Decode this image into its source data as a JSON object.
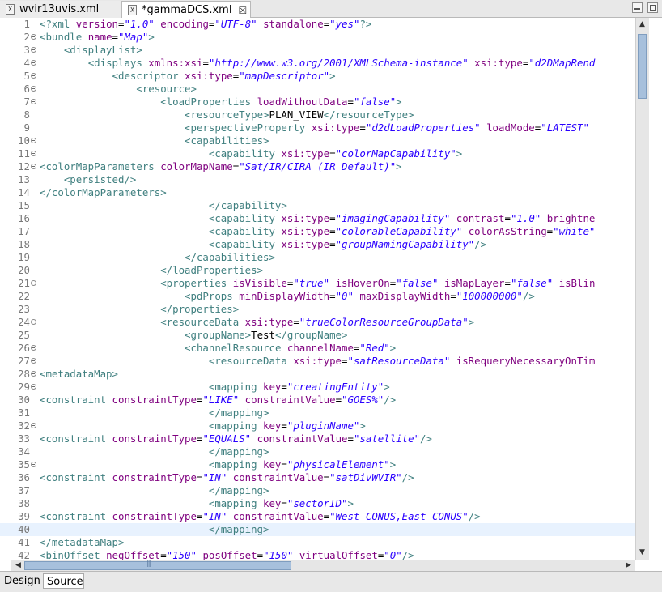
{
  "tabs": [
    {
      "label": "wvir13uvis.xml",
      "icon": "xml-file-icon",
      "active": false
    },
    {
      "label": "*gammaDCS.xml",
      "icon": "xml-file-icon",
      "active": true
    }
  ],
  "bottom_tabs": [
    {
      "label": "Design",
      "active": false
    },
    {
      "label": "Source",
      "active": true
    }
  ],
  "current_line": 40,
  "lines": [
    {
      "n": "1",
      "fold": false,
      "indent": "",
      "tokens": [
        [
          "pi",
          "<?xml "
        ],
        [
          "attr",
          "version"
        ],
        [
          "txt",
          "="
        ],
        [
          "val",
          "\"1.0\""
        ],
        [
          "txt",
          " "
        ],
        [
          "attr",
          "encoding"
        ],
        [
          "txt",
          "="
        ],
        [
          "val",
          "\"UTF-8\""
        ],
        [
          "txt",
          " "
        ],
        [
          "attr",
          "standalone"
        ],
        [
          "txt",
          "="
        ],
        [
          "val",
          "\"yes\""
        ],
        [
          "pi",
          "?>"
        ]
      ]
    },
    {
      "n": "2",
      "fold": true,
      "indent": "",
      "tokens": [
        [
          "tag",
          "<bundle "
        ],
        [
          "attr",
          "name"
        ],
        [
          "txt",
          "="
        ],
        [
          "val",
          "\"Map\""
        ],
        [
          "tag",
          ">"
        ]
      ]
    },
    {
      "n": "3",
      "fold": true,
      "indent": "    ",
      "tokens": [
        [
          "tag",
          "<displayList>"
        ]
      ]
    },
    {
      "n": "4",
      "fold": true,
      "indent": "        ",
      "tokens": [
        [
          "tag",
          "<displays "
        ],
        [
          "attr",
          "xmlns:xsi"
        ],
        [
          "txt",
          "="
        ],
        [
          "val",
          "\"http://www.w3.org/2001/XMLSchema-instance\""
        ],
        [
          "txt",
          " "
        ],
        [
          "attr",
          "xsi:type"
        ],
        [
          "txt",
          "="
        ],
        [
          "val",
          "\"d2DMapRend"
        ]
      ]
    },
    {
      "n": "5",
      "fold": true,
      "indent": "            ",
      "tokens": [
        [
          "tag",
          "<descriptor "
        ],
        [
          "attr",
          "xsi:type"
        ],
        [
          "txt",
          "="
        ],
        [
          "val",
          "\"mapDescriptor\""
        ],
        [
          "tag",
          ">"
        ]
      ]
    },
    {
      "n": "6",
      "fold": true,
      "indent": "                ",
      "tokens": [
        [
          "tag",
          "<resource>"
        ]
      ]
    },
    {
      "n": "7",
      "fold": true,
      "indent": "                    ",
      "tokens": [
        [
          "tag",
          "<loadProperties "
        ],
        [
          "attr",
          "loadWithoutData"
        ],
        [
          "txt",
          "="
        ],
        [
          "val",
          "\"false\""
        ],
        [
          "tag",
          ">"
        ]
      ]
    },
    {
      "n": "8",
      "fold": false,
      "indent": "                        ",
      "tokens": [
        [
          "tag",
          "<resourceType>"
        ],
        [
          "txt",
          "PLAN_VIEW"
        ],
        [
          "tag",
          "</resourceType>"
        ]
      ]
    },
    {
      "n": "9",
      "fold": false,
      "indent": "                        ",
      "tokens": [
        [
          "tag",
          "<perspectiveProperty "
        ],
        [
          "attr",
          "xsi:type"
        ],
        [
          "txt",
          "="
        ],
        [
          "val",
          "\"d2dLoadProperties\""
        ],
        [
          "txt",
          " "
        ],
        [
          "attr",
          "loadMode"
        ],
        [
          "txt",
          "="
        ],
        [
          "val",
          "\"LATEST\""
        ]
      ]
    },
    {
      "n": "10",
      "fold": true,
      "indent": "                        ",
      "tokens": [
        [
          "tag",
          "<capabilities>"
        ]
      ]
    },
    {
      "n": "11",
      "fold": true,
      "indent": "                            ",
      "tokens": [
        [
          "tag",
          "<capability "
        ],
        [
          "attr",
          "xsi:type"
        ],
        [
          "txt",
          "="
        ],
        [
          "val",
          "\"colorMapCapability\""
        ],
        [
          "tag",
          ">"
        ]
      ]
    },
    {
      "n": "12",
      "fold": true,
      "indent": "",
      "tokens": [
        [
          "tag",
          "<colorMapParameters "
        ],
        [
          "attr",
          "colorMapName"
        ],
        [
          "txt",
          "="
        ],
        [
          "val",
          "\"Sat/IR/CIRA (IR Default)\""
        ],
        [
          "tag",
          ">"
        ]
      ]
    },
    {
      "n": "13",
      "fold": false,
      "indent": "    ",
      "tokens": [
        [
          "tag",
          "<persisted/>"
        ]
      ]
    },
    {
      "n": "14",
      "fold": false,
      "indent": "",
      "tokens": [
        [
          "tag",
          "</colorMapParameters>"
        ]
      ]
    },
    {
      "n": "15",
      "fold": false,
      "indent": "                            ",
      "tokens": [
        [
          "tag",
          "</capability>"
        ]
      ]
    },
    {
      "n": "16",
      "fold": false,
      "indent": "                            ",
      "tokens": [
        [
          "tag",
          "<capability "
        ],
        [
          "attr",
          "xsi:type"
        ],
        [
          "txt",
          "="
        ],
        [
          "val",
          "\"imagingCapability\""
        ],
        [
          "txt",
          " "
        ],
        [
          "attr",
          "contrast"
        ],
        [
          "txt",
          "="
        ],
        [
          "val",
          "\"1.0\""
        ],
        [
          "txt",
          " "
        ],
        [
          "attr",
          "brightne"
        ]
      ]
    },
    {
      "n": "17",
      "fold": false,
      "indent": "                            ",
      "tokens": [
        [
          "tag",
          "<capability "
        ],
        [
          "attr",
          "xsi:type"
        ],
        [
          "txt",
          "="
        ],
        [
          "val",
          "\"colorableCapability\""
        ],
        [
          "txt",
          " "
        ],
        [
          "attr",
          "colorAsString"
        ],
        [
          "txt",
          "="
        ],
        [
          "val",
          "\"white\""
        ]
      ]
    },
    {
      "n": "18",
      "fold": false,
      "indent": "                            ",
      "tokens": [
        [
          "tag",
          "<capability "
        ],
        [
          "attr",
          "xsi:type"
        ],
        [
          "txt",
          "="
        ],
        [
          "val",
          "\"groupNamingCapability\""
        ],
        [
          "tag",
          "/>"
        ]
      ]
    },
    {
      "n": "19",
      "fold": false,
      "indent": "                        ",
      "tokens": [
        [
          "tag",
          "</capabilities>"
        ]
      ]
    },
    {
      "n": "20",
      "fold": false,
      "indent": "                    ",
      "tokens": [
        [
          "tag",
          "</loadProperties>"
        ]
      ]
    },
    {
      "n": "21",
      "fold": true,
      "indent": "                    ",
      "tokens": [
        [
          "tag",
          "<properties "
        ],
        [
          "attr",
          "isVisible"
        ],
        [
          "txt",
          "="
        ],
        [
          "val",
          "\"true\""
        ],
        [
          "txt",
          " "
        ],
        [
          "attr",
          "isHoverOn"
        ],
        [
          "txt",
          "="
        ],
        [
          "val",
          "\"false\""
        ],
        [
          "txt",
          " "
        ],
        [
          "attr",
          "isMapLayer"
        ],
        [
          "txt",
          "="
        ],
        [
          "val",
          "\"false\""
        ],
        [
          "txt",
          " "
        ],
        [
          "attr",
          "isBlin"
        ]
      ]
    },
    {
      "n": "22",
      "fold": false,
      "indent": "                        ",
      "tokens": [
        [
          "tag",
          "<pdProps "
        ],
        [
          "attr",
          "minDisplayWidth"
        ],
        [
          "txt",
          "="
        ],
        [
          "val",
          "\"0\""
        ],
        [
          "txt",
          " "
        ],
        [
          "attr",
          "maxDisplayWidth"
        ],
        [
          "txt",
          "="
        ],
        [
          "val",
          "\"100000000\""
        ],
        [
          "tag",
          "/>"
        ]
      ]
    },
    {
      "n": "23",
      "fold": false,
      "indent": "                    ",
      "tokens": [
        [
          "tag",
          "</properties>"
        ]
      ]
    },
    {
      "n": "24",
      "fold": true,
      "indent": "                    ",
      "tokens": [
        [
          "tag",
          "<resourceData "
        ],
        [
          "attr",
          "xsi:type"
        ],
        [
          "txt",
          "="
        ],
        [
          "val",
          "\"trueColorResourceGroupData\""
        ],
        [
          "tag",
          ">"
        ]
      ]
    },
    {
      "n": "25",
      "fold": false,
      "indent": "                        ",
      "tokens": [
        [
          "tag",
          "<groupName>"
        ],
        [
          "txt",
          "Test"
        ],
        [
          "tag",
          "</groupName>"
        ]
      ]
    },
    {
      "n": "26",
      "fold": true,
      "indent": "                        ",
      "tokens": [
        [
          "tag",
          "<channelResource "
        ],
        [
          "attr",
          "channelName"
        ],
        [
          "txt",
          "="
        ],
        [
          "val",
          "\"Red\""
        ],
        [
          "tag",
          ">"
        ]
      ]
    },
    {
      "n": "27",
      "fold": true,
      "indent": "                            ",
      "tokens": [
        [
          "tag",
          "<resourceData "
        ],
        [
          "attr",
          "xsi:type"
        ],
        [
          "txt",
          "="
        ],
        [
          "val",
          "\"satResourceData\""
        ],
        [
          "txt",
          " "
        ],
        [
          "attr",
          "isRequeryNecessaryOnTim"
        ]
      ]
    },
    {
      "n": "28",
      "fold": true,
      "indent": "",
      "tokens": [
        [
          "tag",
          "<metadataMap>"
        ]
      ]
    },
    {
      "n": "29",
      "fold": true,
      "indent": "                            ",
      "tokens": [
        [
          "tag",
          "<mapping "
        ],
        [
          "attr",
          "key"
        ],
        [
          "txt",
          "="
        ],
        [
          "val",
          "\"creatingEntity\""
        ],
        [
          "tag",
          ">"
        ]
      ]
    },
    {
      "n": "30",
      "fold": false,
      "indent": "",
      "tokens": [
        [
          "tag",
          "<constraint "
        ],
        [
          "attr",
          "constraintType"
        ],
        [
          "txt",
          "="
        ],
        [
          "val",
          "\"LIKE\""
        ],
        [
          "txt",
          " "
        ],
        [
          "attr",
          "constraintValue"
        ],
        [
          "txt",
          "="
        ],
        [
          "val",
          "\"GOES%\""
        ],
        [
          "tag",
          "/>"
        ]
      ]
    },
    {
      "n": "31",
      "fold": false,
      "indent": "                            ",
      "tokens": [
        [
          "tag",
          "</mapping>"
        ]
      ]
    },
    {
      "n": "32",
      "fold": true,
      "indent": "                            ",
      "tokens": [
        [
          "tag",
          "<mapping "
        ],
        [
          "attr",
          "key"
        ],
        [
          "txt",
          "="
        ],
        [
          "val",
          "\"pluginName\""
        ],
        [
          "tag",
          ">"
        ]
      ]
    },
    {
      "n": "33",
      "fold": false,
      "indent": "",
      "tokens": [
        [
          "tag",
          "<constraint "
        ],
        [
          "attr",
          "constraintType"
        ],
        [
          "txt",
          "="
        ],
        [
          "val",
          "\"EQUALS\""
        ],
        [
          "txt",
          " "
        ],
        [
          "attr",
          "constraintValue"
        ],
        [
          "txt",
          "="
        ],
        [
          "val",
          "\"satellite\""
        ],
        [
          "tag",
          "/>"
        ]
      ]
    },
    {
      "n": "34",
      "fold": false,
      "indent": "                            ",
      "tokens": [
        [
          "tag",
          "</mapping>"
        ]
      ]
    },
    {
      "n": "35",
      "fold": true,
      "indent": "                            ",
      "tokens": [
        [
          "tag",
          "<mapping "
        ],
        [
          "attr",
          "key"
        ],
        [
          "txt",
          "="
        ],
        [
          "val",
          "\"physicalElement\""
        ],
        [
          "tag",
          ">"
        ]
      ]
    },
    {
      "n": "36",
      "fold": false,
      "indent": "",
      "tokens": [
        [
          "tag",
          "<constraint "
        ],
        [
          "attr",
          "constraintType"
        ],
        [
          "txt",
          "="
        ],
        [
          "val",
          "\"IN\""
        ],
        [
          "txt",
          " "
        ],
        [
          "attr",
          "constraintValue"
        ],
        [
          "txt",
          "="
        ],
        [
          "val",
          "\"satDivWVIR\""
        ],
        [
          "tag",
          "/>"
        ]
      ]
    },
    {
      "n": "37",
      "fold": false,
      "indent": "                            ",
      "tokens": [
        [
          "tag",
          "</mapping>"
        ]
      ]
    },
    {
      "n": "38",
      "fold": false,
      "indent": "                            ",
      "tokens": [
        [
          "tag",
          "<mapping "
        ],
        [
          "attr",
          "key"
        ],
        [
          "txt",
          "="
        ],
        [
          "val",
          "\"sectorID\""
        ],
        [
          "tag",
          ">"
        ]
      ]
    },
    {
      "n": "39",
      "fold": false,
      "indent": "",
      "tokens": [
        [
          "tag",
          "<constraint "
        ],
        [
          "attr",
          "constraintType"
        ],
        [
          "txt",
          "="
        ],
        [
          "val",
          "\"IN\""
        ],
        [
          "txt",
          " "
        ],
        [
          "attr",
          "constraintValue"
        ],
        [
          "txt",
          "="
        ],
        [
          "val",
          "\"West CONUS,East CONUS\""
        ],
        [
          "tag",
          "/>"
        ]
      ]
    },
    {
      "n": "40",
      "fold": false,
      "indent": "                            ",
      "tokens": [
        [
          "tag",
          "</mapping>"
        ]
      ]
    },
    {
      "n": "41",
      "fold": false,
      "indent": "",
      "tokens": [
        [
          "tag",
          "</metadataMap>"
        ]
      ]
    },
    {
      "n": "42",
      "fold": false,
      "indent": "",
      "tokens": [
        [
          "tag",
          "<binOffset "
        ],
        [
          "attr",
          "negOffset"
        ],
        [
          "txt",
          "="
        ],
        [
          "val",
          "\"150\""
        ],
        [
          "txt",
          " "
        ],
        [
          "attr",
          "posOffset"
        ],
        [
          "txt",
          "="
        ],
        [
          "val",
          "\"150\""
        ],
        [
          "txt",
          " "
        ],
        [
          "attr",
          "virtualOffset"
        ],
        [
          "txt",
          "="
        ],
        [
          "val",
          "\"0\""
        ],
        [
          "tag",
          "/>"
        ]
      ]
    }
  ]
}
